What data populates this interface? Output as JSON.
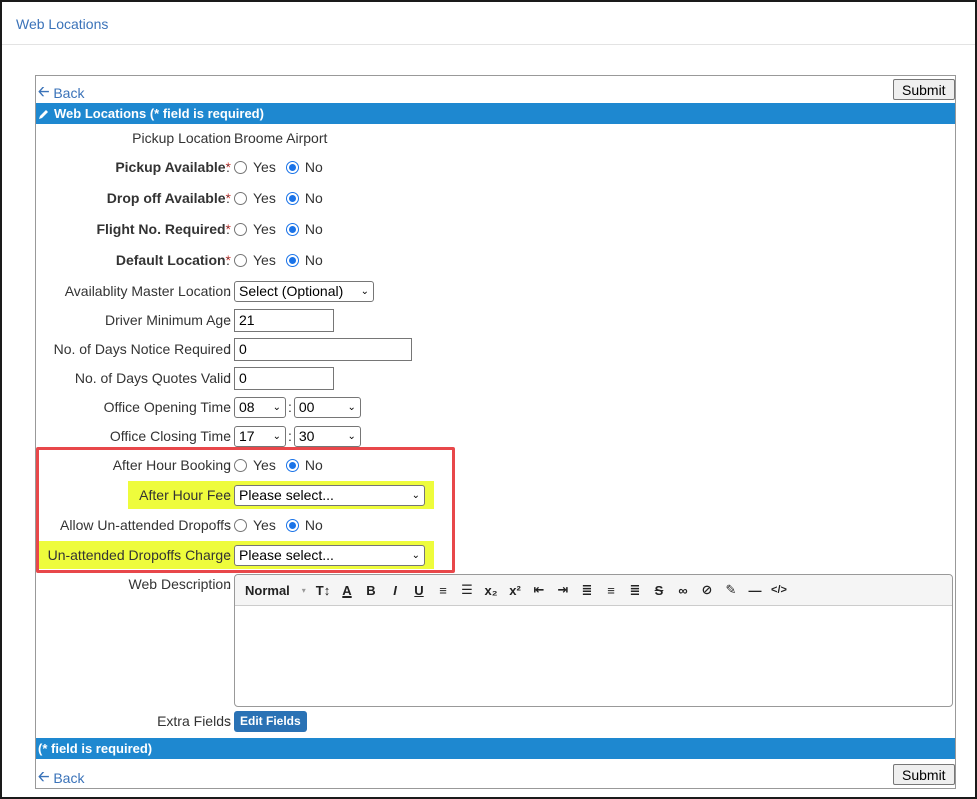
{
  "header": {
    "title": "Web Locations"
  },
  "nav": {
    "back_label": "Back",
    "submit_label": "Submit"
  },
  "bars": {
    "top": "Web Locations (* field is required)",
    "bottom": "(* field is required)"
  },
  "fields": {
    "pickup_location": {
      "label": "Pickup Location",
      "value": "Broome Airport"
    },
    "pickup_available": {
      "label": "Pickup Available",
      "selected": "No"
    },
    "dropoff_available": {
      "label": "Drop off Available",
      "selected": "No"
    },
    "flight_no_required": {
      "label": "Flight No. Required",
      "selected": "No"
    },
    "default_location": {
      "label": "Default Location",
      "selected": "No"
    },
    "availability_master": {
      "label": "Availablity Master Location",
      "value": "Select (Optional)"
    },
    "driver_min_age": {
      "label": "Driver Minimum Age",
      "value": "21"
    },
    "days_notice": {
      "label": "No. of Days Notice Required",
      "value": "0"
    },
    "days_quotes_valid": {
      "label": "No. of Days Quotes Valid",
      "value": "0"
    },
    "office_opening": {
      "label": "Office Opening Time",
      "hour": "08",
      "minute": "00"
    },
    "office_closing": {
      "label": "Office Closing Time",
      "hour": "17",
      "minute": "30"
    },
    "after_hour_booking": {
      "label": "After Hour Booking",
      "selected": "No"
    },
    "after_hour_fee": {
      "label": "After Hour Fee",
      "value": "Please select..."
    },
    "allow_unattended": {
      "label": "Allow Un-attended Dropoffs",
      "selected": "No"
    },
    "unattended_charge": {
      "label": "Un-attended Dropoffs Charge",
      "value": "Please select..."
    },
    "web_description": {
      "label": "Web Description"
    },
    "extra_fields": {
      "label": "Extra Fields",
      "button": "Edit Fields"
    }
  },
  "radio_options": {
    "yes": "Yes",
    "no": "No"
  },
  "required_mark": "*",
  "colon": ":",
  "editor": {
    "format_label": "Normal"
  },
  "colors": {
    "accent": "#1e88d0",
    "link": "#3b73b9",
    "highlight": "#eefc3c",
    "annotation": "#e8474a"
  }
}
